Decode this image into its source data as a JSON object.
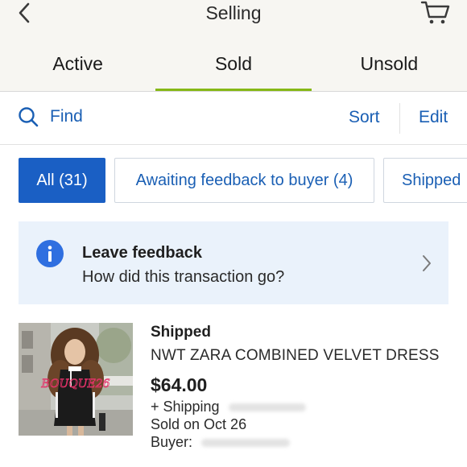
{
  "header": {
    "title": "Selling",
    "back_icon": "chevron-left-icon",
    "cart_icon": "cart-icon"
  },
  "tabs": [
    {
      "label": "Active",
      "selected": false
    },
    {
      "label": "Sold",
      "selected": true
    },
    {
      "label": "Unsold",
      "selected": false
    }
  ],
  "toolbar": {
    "find_label": "Find",
    "sort_label": "Sort",
    "edit_label": "Edit"
  },
  "filters": [
    {
      "label": "All (31)",
      "selected": true
    },
    {
      "label": "Awaiting feedback to buyer (4)",
      "selected": false
    },
    {
      "label": "Shipped",
      "selected": false
    }
  ],
  "banner": {
    "title": "Leave feedback",
    "subtitle": "How did this transaction go?",
    "icon": "info-icon"
  },
  "item": {
    "status": "Shipped",
    "title": "NWT ZARA COMBINED VELVET DRESS",
    "price": "$64.00",
    "shipping": "+ Shipping",
    "sold_on": "Sold on Oct 26",
    "buyer_label": "Buyer:",
    "watermark": "BOUQUE26"
  },
  "colors": {
    "link_blue": "#1a5fb4",
    "selected_chip": "#1a5fc4",
    "tab_underline": "#86b817",
    "banner_bg": "#eaf2fb",
    "info_icon": "#2f6fe0"
  }
}
